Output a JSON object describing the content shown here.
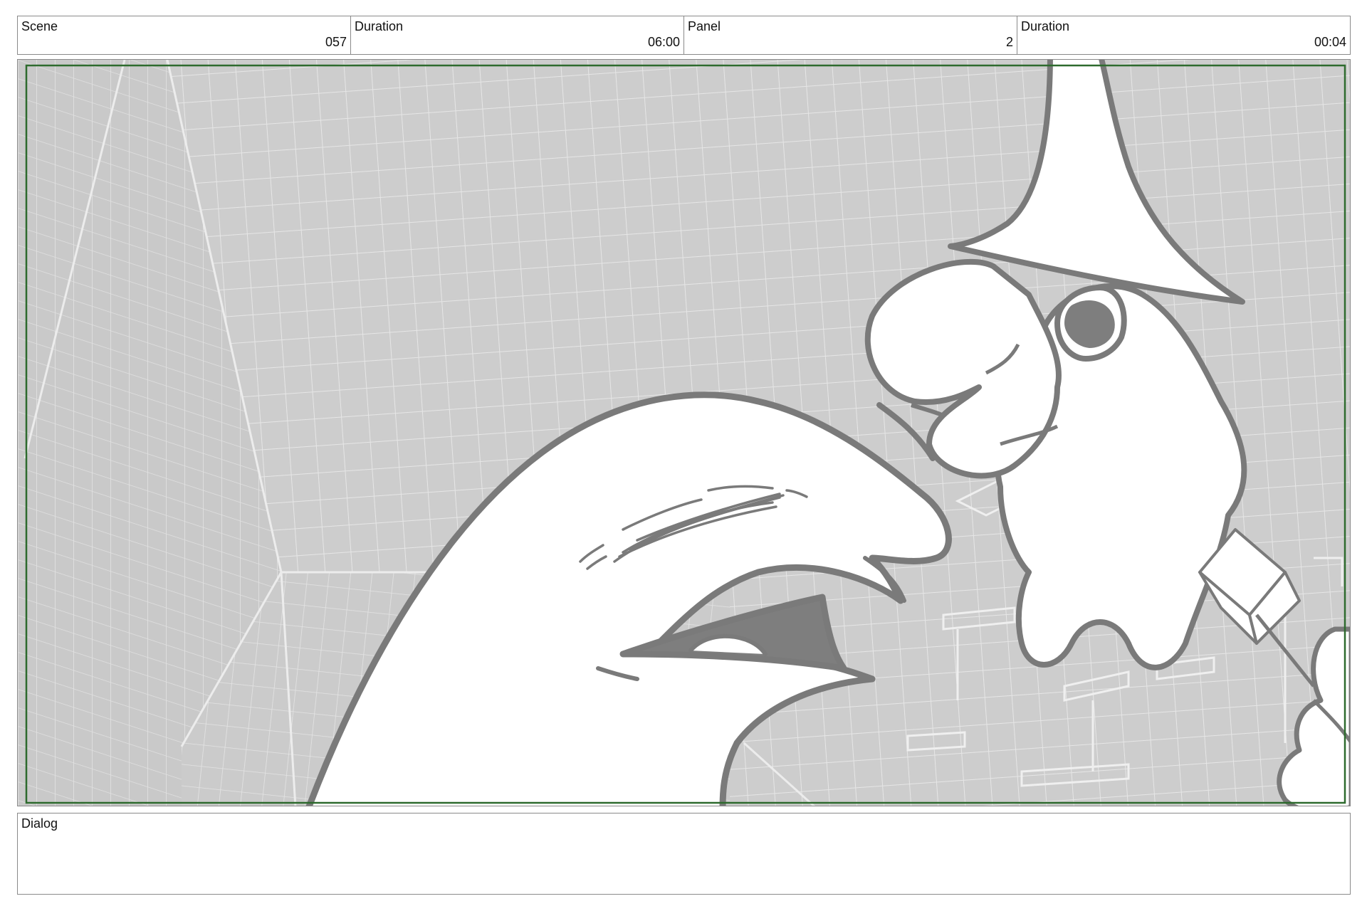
{
  "header": {
    "scene_label": "Scene",
    "scene_value": "057",
    "duration_label": "Duration",
    "duration_value": "06:00",
    "panel_label": "Panel",
    "panel_value": "2",
    "panel_duration_label": "Duration",
    "panel_duration_value": "00:04"
  },
  "dialog": {
    "label": "Dialog",
    "text": ""
  },
  "colors": {
    "safe_frame": "#2e6b2e",
    "line": "#7a7a7a",
    "background": "#cdcdcd"
  }
}
